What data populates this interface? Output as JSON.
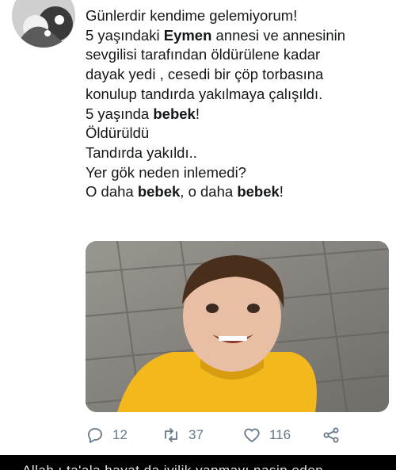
{
  "tweet": {
    "lines": [
      [
        {
          "t": "Günlerdir kendime gelemiyorum!",
          "b": false
        }
      ],
      [
        {
          "t": "5 yaşındaki ",
          "b": false
        },
        {
          "t": "Eymen",
          "b": true
        },
        {
          "t": " annesi ve annesinin",
          "b": false
        }
      ],
      [
        {
          "t": "sevgilisi tarafından öldürülene kadar",
          "b": false
        }
      ],
      [
        {
          "t": "dayak yedi , cesedi bir çöp torbasına",
          "b": false
        }
      ],
      [
        {
          "t": "konulup tandırda yakılmaya çalışıldı.",
          "b": false
        }
      ],
      [
        {
          "t": "5 yaşında ",
          "b": false
        },
        {
          "t": "bebek",
          "b": true
        },
        {
          "t": "!",
          "b": false
        }
      ],
      [
        {
          "t": "Öldürüldü",
          "b": false
        }
      ],
      [
        {
          "t": "Tandırda yakıldı..",
          "b": false
        }
      ],
      [
        {
          "t": "Yer gök neden inlemedi?",
          "b": false
        }
      ],
      [
        {
          "t": "O daha ",
          "b": false
        },
        {
          "t": "bebek",
          "b": true
        },
        {
          "t": ", o daha ",
          "b": false
        },
        {
          "t": "bebek",
          "b": true
        },
        {
          "t": "!",
          "b": false
        }
      ]
    ]
  },
  "actions": {
    "reply_count": "12",
    "retweet_count": "37",
    "like_count": "116"
  },
  "icons": {
    "reply": "reply-icon",
    "retweet": "retweet-icon",
    "like": "heart-icon",
    "share": "share-icon"
  },
  "colors": {
    "text": "#14171a",
    "secondary": "#657786",
    "shirt": "#f2b81c",
    "bottom_bar": "#000000"
  },
  "bottom": {
    "next_tweet_text": "Allah ı ta'ala hayat da iyilik yapmayı nasip eden"
  }
}
